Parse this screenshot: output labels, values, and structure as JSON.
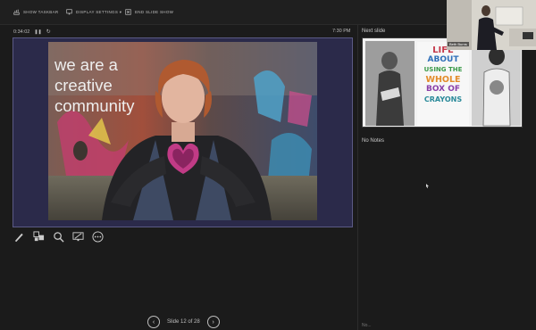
{
  "toolbar": {
    "show_taskbar": "SHOW TASKBAR",
    "display_settings": "DISPLAY SETTINGS ▾",
    "end_slide_show": "END SLIDE SHOW"
  },
  "timer": {
    "elapsed": "0:34:02"
  },
  "clock": {
    "time": "7:30 PM"
  },
  "current_slide": {
    "text_lines": [
      "we are a",
      "creative",
      "community"
    ]
  },
  "next_slide": {
    "label": "Next slide",
    "poster_text": [
      "LIFE",
      "ABOUT",
      "USING THE",
      "WHOLE",
      "BOX OF",
      "CRAYONS"
    ]
  },
  "notes": {
    "label": "No Notes",
    "footer": "No..."
  },
  "navigation": {
    "counter": "Slide 12 of 28",
    "prev": "‹",
    "next": "›"
  },
  "webcam": {
    "name": "Beth Burns"
  },
  "colors": {
    "slide_bg": "#2b2a4a",
    "panel_bg": "#1b1b1b",
    "accent": "#5b5a85"
  }
}
